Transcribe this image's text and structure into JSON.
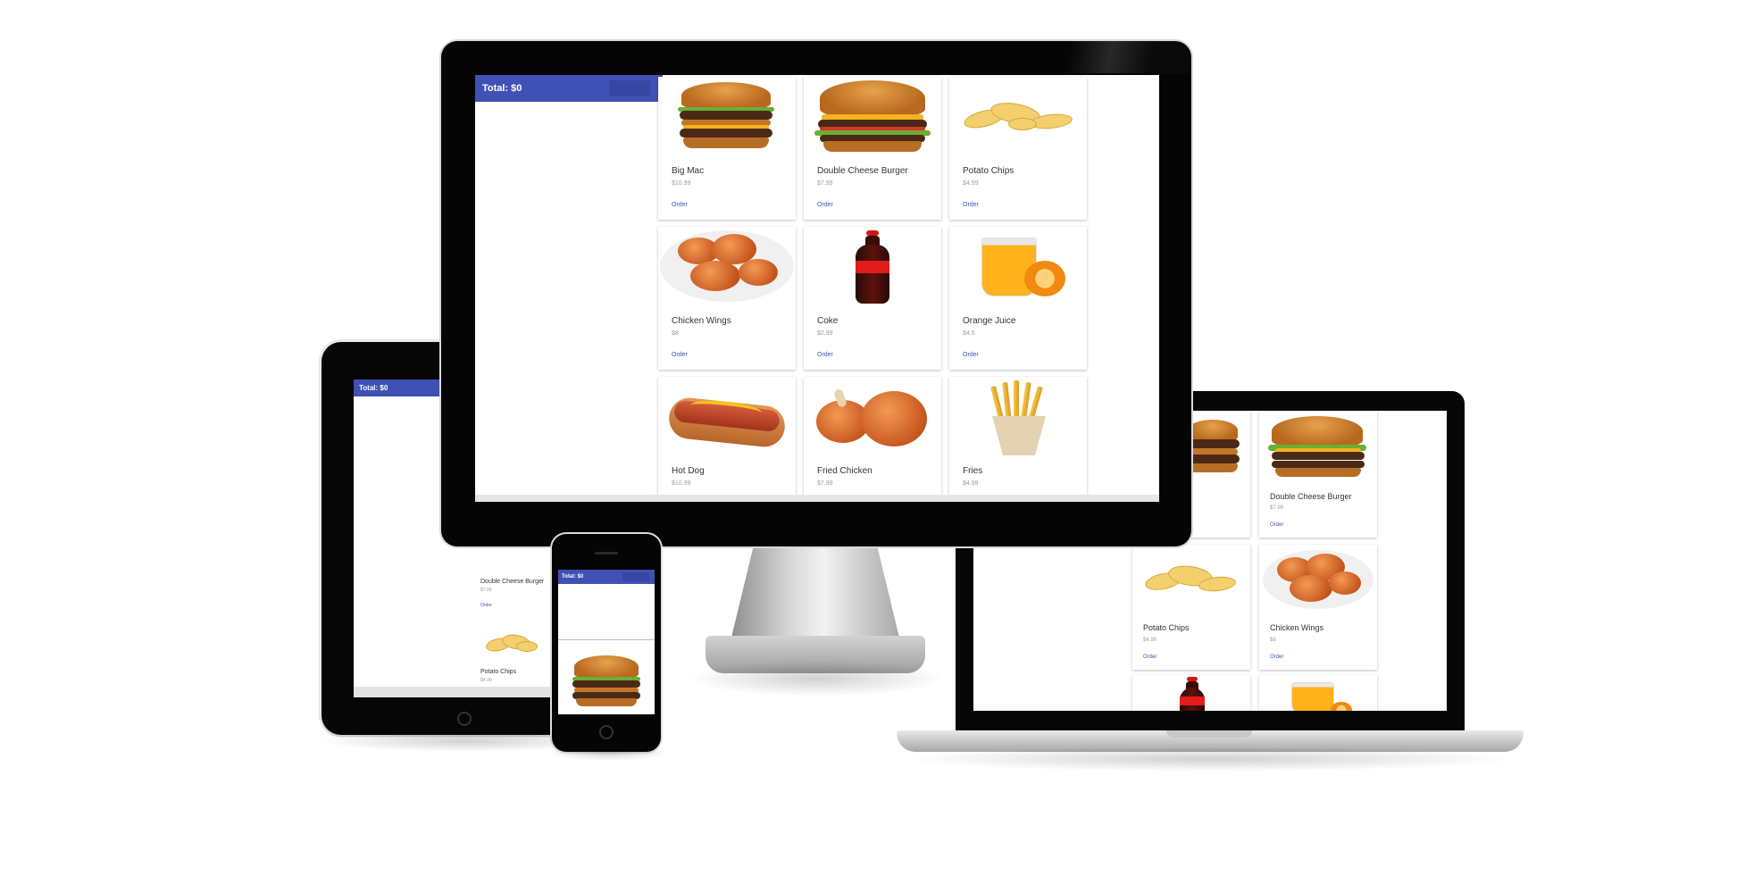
{
  "app": {
    "total_label": "Total: $0",
    "order_label": "Order"
  },
  "menu": [
    {
      "name": "Big Mac",
      "price": "$10.99",
      "image": "big-mac"
    },
    {
      "name": "Double Cheese Burger",
      "price": "$7.99",
      "image": "double-cheese-burger"
    },
    {
      "name": "Potato Chips",
      "price": "$4.99",
      "image": "potato-chips"
    },
    {
      "name": "Chicken Wings",
      "price": "$8",
      "image": "chicken-wings"
    },
    {
      "name": "Coke",
      "price": "$2.99",
      "image": "coke-bottle"
    },
    {
      "name": "Orange Juice",
      "price": "$4.5",
      "image": "orange-juice"
    },
    {
      "name": "Hot Dog",
      "price": "$10.99",
      "image": "hot-dog"
    },
    {
      "name": "Fried Chicken",
      "price": "$7.99",
      "image": "fried-chicken"
    },
    {
      "name": "Fries",
      "price": "$4.99",
      "image": "fries"
    }
  ],
  "colors": {
    "primary": "#3f51b5",
    "device_bezel": "#050505",
    "stand": "#bdbdbd"
  }
}
